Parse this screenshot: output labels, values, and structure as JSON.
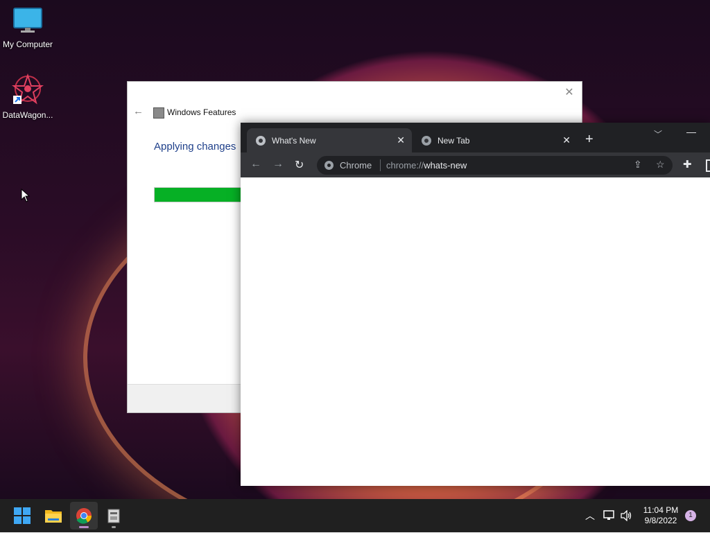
{
  "desktop": {
    "icons": [
      {
        "label": "My Computer",
        "icon": "monitor-icon"
      },
      {
        "label": "DataWagon...",
        "icon": "datawagon-icon"
      }
    ]
  },
  "windows_features": {
    "title": "Windows Features",
    "heading": "Applying changes",
    "progress": 0.22,
    "accent": "#06b025"
  },
  "chrome": {
    "tabs": [
      {
        "label": "What's New",
        "active": true
      },
      {
        "label": "New Tab",
        "active": false
      }
    ],
    "omnibox": {
      "chip": "Chrome",
      "scheme": "chrome://",
      "host": "whats-new"
    }
  },
  "taskbar": {
    "apps": [
      "windows-start-icon",
      "file-explorer-icon",
      "chrome-icon",
      "installer-icon"
    ],
    "time": "11:04 PM",
    "date": "9/8/2022",
    "notification_count": "1"
  }
}
